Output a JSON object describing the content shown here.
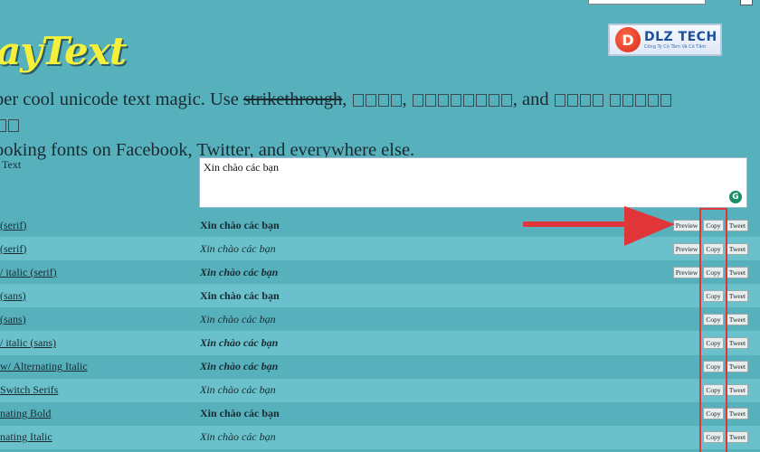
{
  "header": {
    "logo_text": "ayText",
    "brand": {
      "name": "DLZ TECH",
      "mark": "D",
      "tagline": "Công Ty Có Tâm Và Có Tầm"
    }
  },
  "intro": {
    "part1": "per cool unicode text magic. Use ",
    "strike": "strikethrough",
    "part2": ", ",
    "part3": ", ",
    "part4": ", and ",
    "line2": "ooking fonts on Facebook, Twitter, and everywhere else."
  },
  "input": {
    "label": "Text",
    "value": "Xin chào các bạn"
  },
  "buttons": {
    "preview": "Preview",
    "copy": "Copy",
    "tweet": "Tweet"
  },
  "rows": [
    {
      "name": "(serif)",
      "sample": "Xin chào các bạn",
      "style": "bold",
      "preview": true
    },
    {
      "name": "(serif)",
      "sample": "Xin chào các bạn",
      "style": "italic",
      "preview": true
    },
    {
      "name": "/ italic (serif)",
      "sample": "Xin chào các bạn",
      "style": "bolditalic",
      "preview": true
    },
    {
      "name": "(sans)",
      "sample": "Xin chào các bạn",
      "style": "bold",
      "preview": false
    },
    {
      "name": "(sans)",
      "sample": "Xin chào các bạn",
      "style": "italic",
      "preview": false
    },
    {
      "name": "/ italic (sans)",
      "sample": "Xin chào các bạn",
      "style": "bolditalic",
      "preview": false
    },
    {
      "name": "w/ Alternating Italic",
      "sample": "Xin chào các bạn",
      "style": "bolditalic",
      "preview": false
    },
    {
      "name": "Switch Serifs",
      "sample": "Xin chào các bạn",
      "style": "italic",
      "preview": false
    },
    {
      "name": "nating Bold",
      "sample": "Xin chào các bạn",
      "style": "bold",
      "preview": false
    },
    {
      "name": "nating Italic",
      "sample": "Xin chào các bạn",
      "style": "italic",
      "preview": false
    }
  ],
  "colors": {
    "background": "#56b1bd",
    "row_alt": "#6ac0cb",
    "logo": "#f6f03a",
    "annotation": "#e0363a"
  }
}
